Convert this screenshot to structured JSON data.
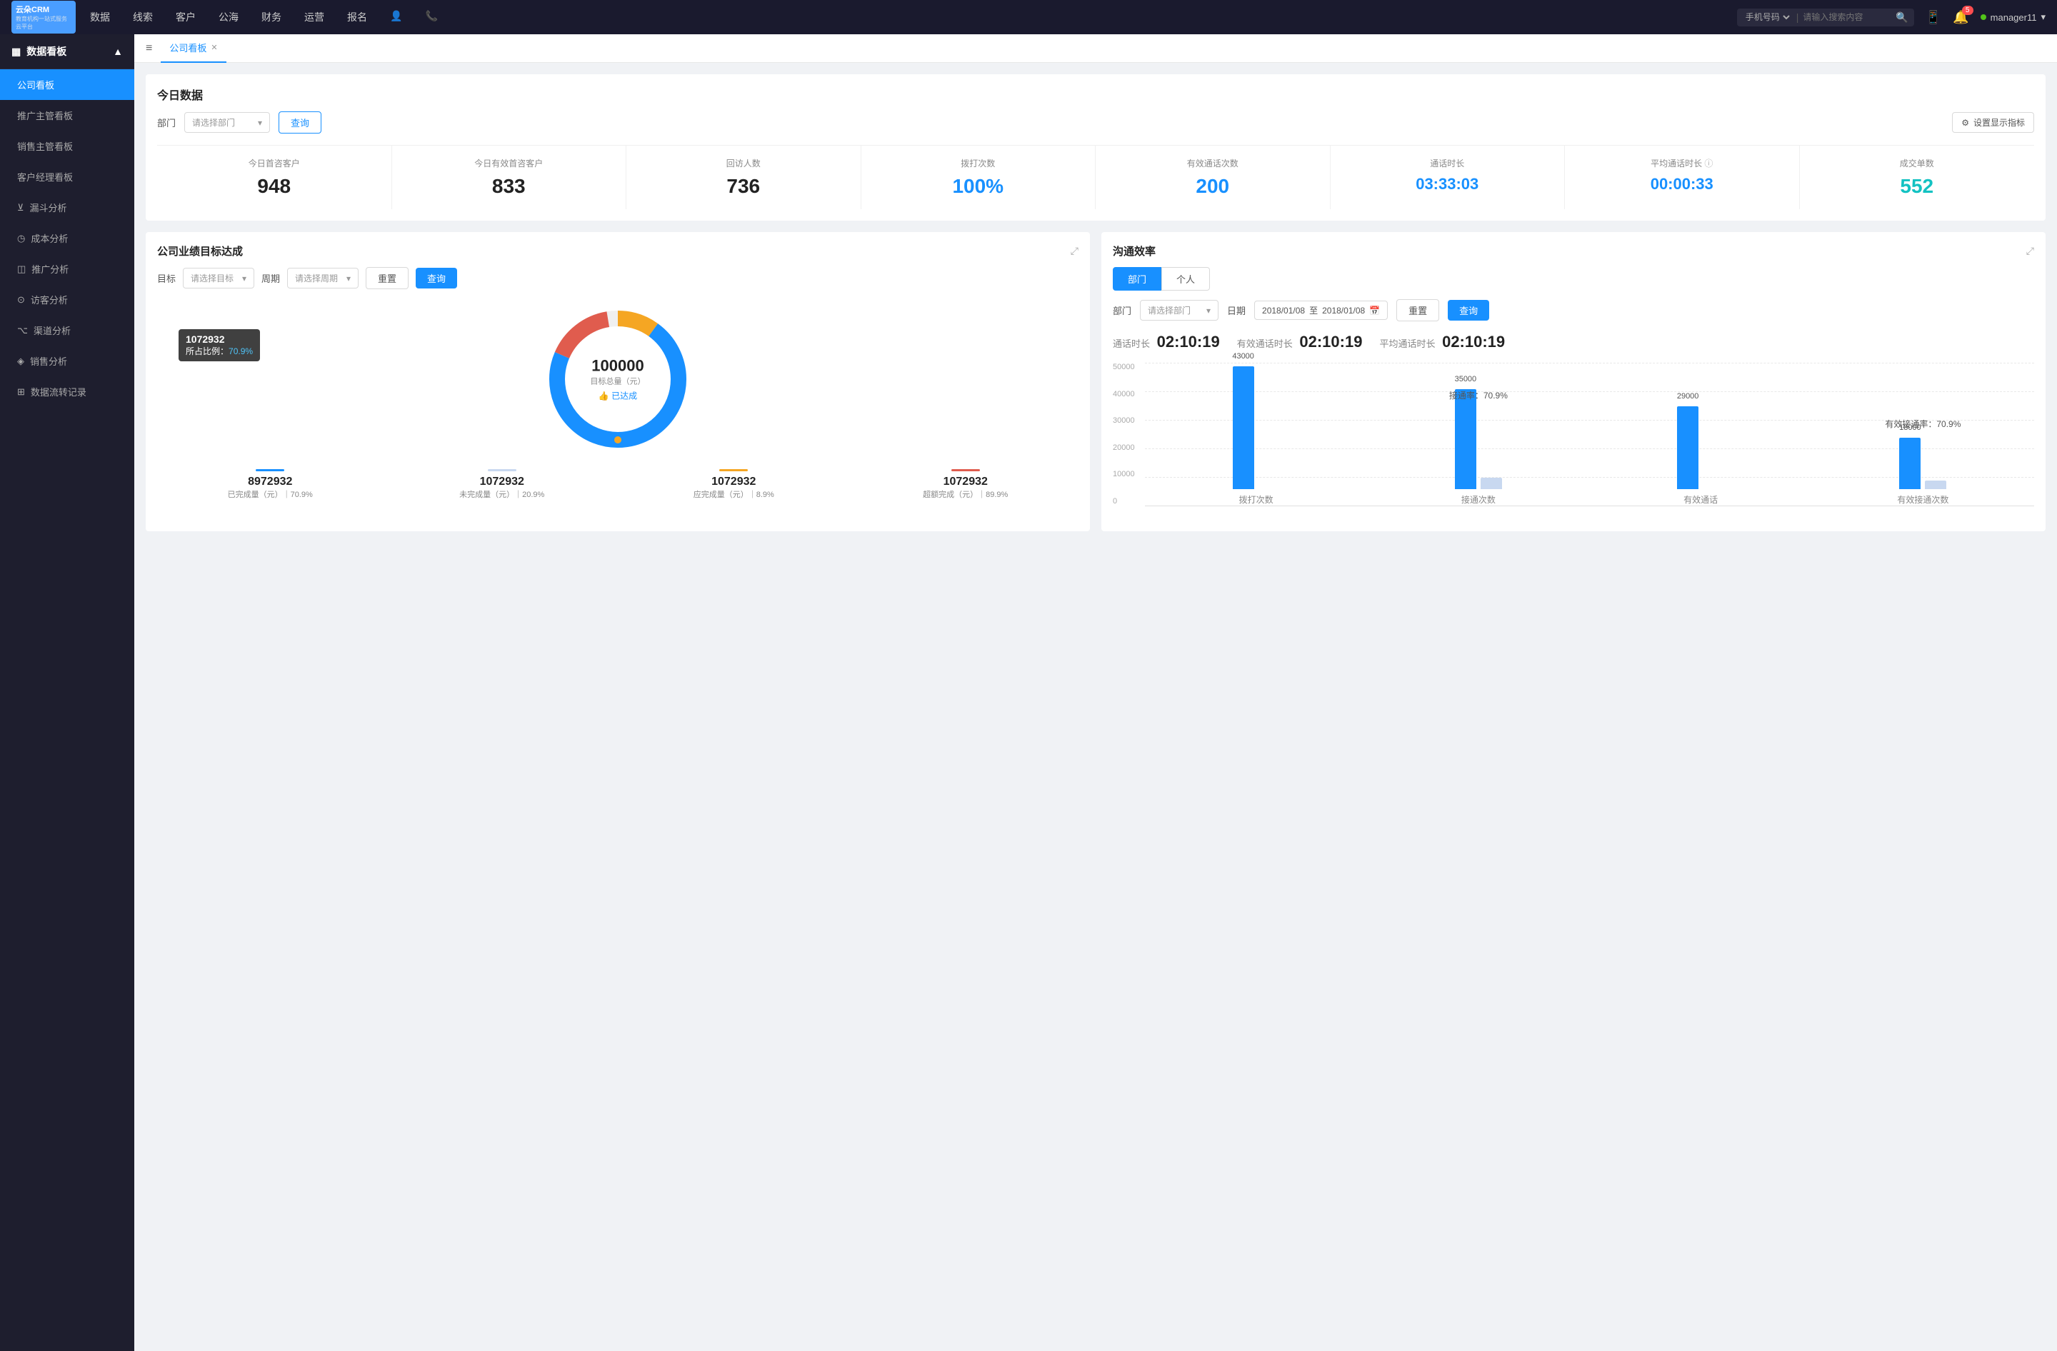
{
  "app": {
    "logo_line1": "云朵CRM",
    "logo_line2": "教育机构一站式服务云平台"
  },
  "topnav": {
    "items": [
      "数据",
      "线索",
      "客户",
      "公海",
      "财务",
      "运营",
      "报名"
    ],
    "search_placeholder": "请输入搜索内容",
    "search_select": "手机号码",
    "badge_count": "5",
    "username": "manager11"
  },
  "sidebar": {
    "section": "数据看板",
    "items": [
      {
        "label": "公司看板",
        "active": true
      },
      {
        "label": "推广主管看板",
        "active": false
      },
      {
        "label": "销售主管看板",
        "active": false
      },
      {
        "label": "客户经理看板",
        "active": false
      },
      {
        "label": "漏斗分析",
        "active": false
      },
      {
        "label": "成本分析",
        "active": false
      },
      {
        "label": "推广分析",
        "active": false
      },
      {
        "label": "访客分析",
        "active": false
      },
      {
        "label": "渠道分析",
        "active": false
      },
      {
        "label": "销售分析",
        "active": false
      },
      {
        "label": "数据流转记录",
        "active": false
      }
    ]
  },
  "tabs": {
    "active": "公司看板",
    "items": [
      "公司看板"
    ]
  },
  "today": {
    "title": "今日数据",
    "dept_label": "部门",
    "dept_placeholder": "请选择部门",
    "query_btn": "查询",
    "settings_btn": "设置显示指标",
    "stats": [
      {
        "label": "今日首咨客户",
        "value": "948",
        "color": "dark"
      },
      {
        "label": "今日有效首咨客户",
        "value": "833",
        "color": "dark"
      },
      {
        "label": "回访人数",
        "value": "736",
        "color": "dark"
      },
      {
        "label": "拨打次数",
        "value": "100%",
        "color": "blue"
      },
      {
        "label": "有效通话次数",
        "value": "200",
        "color": "blue"
      },
      {
        "label": "通话时长",
        "value": "03:33:03",
        "color": "blue"
      },
      {
        "label": "平均通话时长",
        "value": "00:00:33",
        "color": "blue"
      },
      {
        "label": "成交单数",
        "value": "552",
        "color": "cyan"
      }
    ]
  },
  "target": {
    "title": "公司业绩目标达成",
    "target_label": "目标",
    "target_placeholder": "请选择目标",
    "period_label": "周期",
    "period_placeholder": "请选择周期",
    "reset_btn": "重置",
    "query_btn": "查询",
    "tooltip_num": "1072932",
    "tooltip_pct_label": "所占比例：",
    "tooltip_pct": "70.9%",
    "donut_value": "100000",
    "donut_sub": "目标总量（元）",
    "donut_achieved": "👍 已达成",
    "stats": [
      {
        "bar_color": "#1890ff",
        "value": "8972932",
        "label": "已完成量（元）",
        "sub": "70.9%"
      },
      {
        "bar_color": "#c8d8f0",
        "value": "1072932",
        "label": "未完成量（元）",
        "sub": "20.9%"
      },
      {
        "bar_color": "#f5a623",
        "value": "1072932",
        "label": "应完成量（元）",
        "sub": "8.9%"
      },
      {
        "bar_color": "#e0574f",
        "value": "1072932",
        "label": "超额完成（元）",
        "sub": "89.9%"
      }
    ]
  },
  "efficiency": {
    "title": "沟通效率",
    "tabs": [
      "部门",
      "个人"
    ],
    "active_tab": "部门",
    "dept_label": "部门",
    "dept_placeholder": "请选择部门",
    "date_label": "日期",
    "date_start": "2018/01/08",
    "date_end": "2018/01/08",
    "reset_btn": "重置",
    "query_btn": "查询",
    "call_duration_label": "通话时长",
    "call_duration": "02:10:19",
    "eff_call_label": "有效通话时长",
    "eff_call": "02:10:19",
    "avg_call_label": "平均通话时长",
    "avg_call": "02:10:19",
    "chart": {
      "y_labels": [
        "50000",
        "40000",
        "30000",
        "20000",
        "10000",
        "0"
      ],
      "groups": [
        {
          "label": "拨打次数",
          "bars": [
            {
              "value": 43000,
              "label": "43000",
              "color": "#1890ff",
              "height_pct": 86
            },
            {
              "value": 0,
              "label": "",
              "color": "#c8d8f0",
              "height_pct": 0
            }
          ],
          "rate": ""
        },
        {
          "label": "接通次数",
          "bars": [
            {
              "value": 35000,
              "label": "35000",
              "color": "#1890ff",
              "height_pct": 70
            },
            {
              "value": 0,
              "label": "",
              "color": "#c8d8f0",
              "height_pct": 8
            }
          ],
          "rate": "接通率：70.9%"
        },
        {
          "label": "有效通话",
          "bars": [
            {
              "value": 29000,
              "label": "29000",
              "color": "#1890ff",
              "height_pct": 58
            },
            {
              "value": 0,
              "label": "",
              "color": "#c8d8f0",
              "height_pct": 0
            }
          ],
          "rate": ""
        },
        {
          "label": "有效接通次数",
          "bars": [
            {
              "value": 18000,
              "label": "18000",
              "color": "#1890ff",
              "height_pct": 36
            },
            {
              "value": 0,
              "label": "",
              "color": "#c8d8f0",
              "height_pct": 6
            }
          ],
          "rate": "有效接通率：70.9%"
        }
      ]
    }
  }
}
